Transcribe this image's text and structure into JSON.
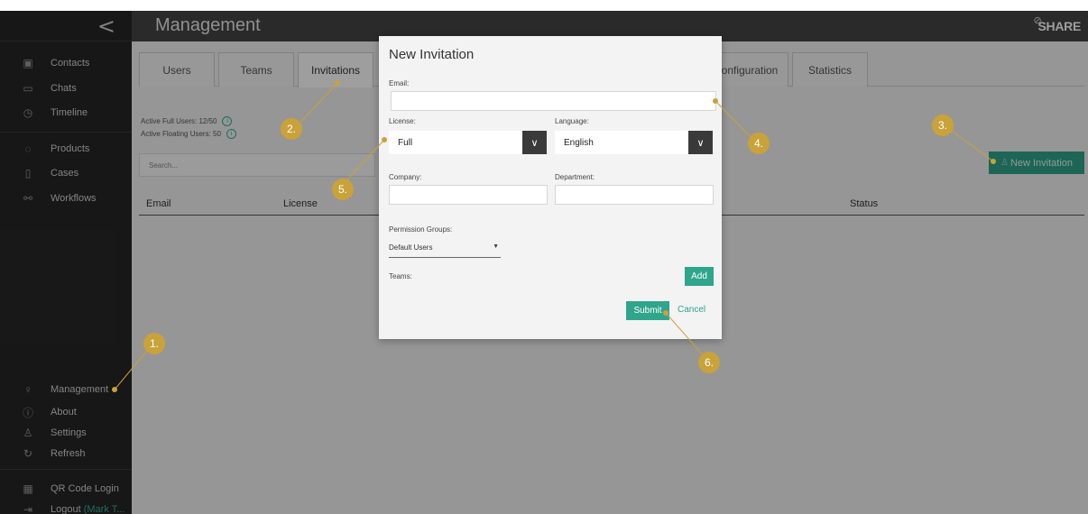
{
  "sidebar": {
    "collapse_glyph": "<",
    "items": [
      {
        "label": "Contacts",
        "icon": "contacts-icon",
        "glyph": "▣"
      },
      {
        "label": "Chats",
        "icon": "chat-icon",
        "glyph": "▭"
      },
      {
        "label": "Timeline",
        "icon": "timeline-icon",
        "glyph": "◷"
      },
      {
        "label": "Products",
        "icon": "products-icon",
        "glyph": "◌"
      },
      {
        "label": "Cases",
        "icon": "cases-icon",
        "glyph": "▯"
      },
      {
        "label": "Workflows",
        "icon": "workflows-icon",
        "glyph": "⚯"
      },
      {
        "label": "Management",
        "icon": "key-icon",
        "glyph": "♀"
      },
      {
        "label": "About",
        "icon": "info-icon",
        "glyph": "ⓘ"
      },
      {
        "label": "Settings",
        "icon": "user-settings-icon",
        "glyph": "♙"
      },
      {
        "label": "Refresh",
        "icon": "refresh-icon",
        "glyph": "↻"
      },
      {
        "label": "QR Code Login",
        "icon": "qr-code-icon",
        "glyph": "▦"
      },
      {
        "label": "Logout",
        "sub": "(Mark T...",
        "icon": "logout-icon",
        "glyph": "⇥"
      }
    ]
  },
  "header": {
    "title": "Management",
    "brand": "SHARE",
    "brand_tag": "⊘"
  },
  "tabs": [
    {
      "label": "Users"
    },
    {
      "label": "Teams"
    },
    {
      "label": "Invitations",
      "active": true
    },
    {
      "label": "onfiguration"
    },
    {
      "label": "Statistics"
    }
  ],
  "stats": {
    "full_users": "Active Full Users:  12/50",
    "floating_users": "Active Floating Users:  50"
  },
  "search": {
    "placeholder": "Search..."
  },
  "table": {
    "headers": {
      "email": "Email",
      "license": "License",
      "status": "Status"
    }
  },
  "new_invitation_button": "New Invitation",
  "modal": {
    "title": "New Invitation",
    "email_label": "Email:",
    "email_value": "",
    "license_label": "License:",
    "license_value": "Full",
    "language_label": "Language:",
    "language_value": "English",
    "company_label": "Company:",
    "company_value": "",
    "department_label": "Department:",
    "department_value": "",
    "permission_label": "Permission Groups:",
    "permission_value": "Default Users",
    "teams_label": "Teams:",
    "add_label": "Add",
    "submit_label": "Submit",
    "cancel_label": "Cancel",
    "chevron": "∨"
  },
  "callouts": [
    "1.",
    "2.",
    "3.",
    "4.",
    "5.",
    "6."
  ],
  "colors": {
    "accent": "#2fa58b",
    "callout": "#c9a23a",
    "sidebar_bg": "#262626",
    "header_bg": "#444444"
  }
}
